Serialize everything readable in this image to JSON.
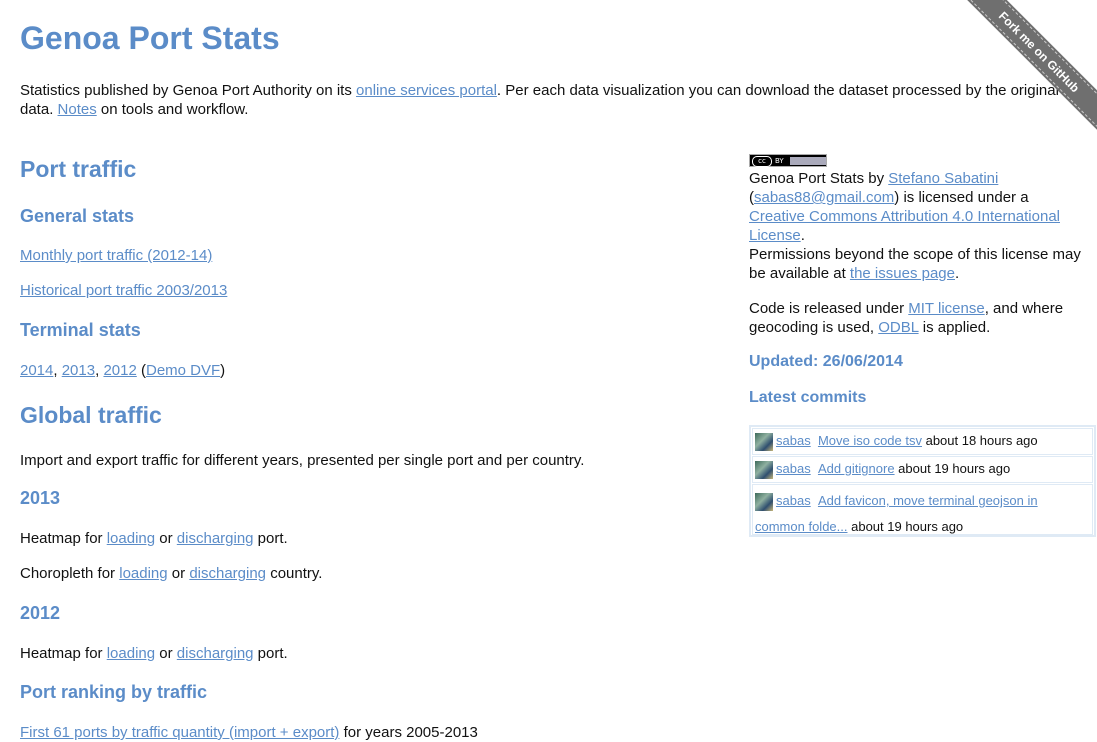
{
  "title": "Genoa Port Stats",
  "intro": {
    "text1": "Statistics published by Genoa Port Authority on its ",
    "link1": "online services portal",
    "text2": ". Per each data visualization you can download the dataset processed by the original data. ",
    "link2": "Notes",
    "text3": " on tools and workflow."
  },
  "ribbon": "Fork me on GitHub",
  "port_traffic": {
    "heading": "Port traffic",
    "general": {
      "heading": "General stats",
      "link_monthly": "Monthly port traffic (2012-14)",
      "link_historical": "Historical port traffic 2003/2013"
    },
    "terminal": {
      "heading": "Terminal stats",
      "y2014": "2014",
      "sep1": ", ",
      "y2013": "2013",
      "sep2": ", ",
      "y2012": "2012",
      "open": " (",
      "demo": "Demo DVF",
      "close": ")"
    }
  },
  "global_traffic": {
    "heading": "Global traffic",
    "desc": "Import and export traffic for different years, presented per single port and per country.",
    "y2013": {
      "heading": "2013",
      "heatmap_prefix": "Heatmap for ",
      "loading": "loading",
      "or": " or ",
      "discharging": "discharging",
      "heatmap_suffix": " port.",
      "choro_prefix": "Choropleth for ",
      "choro_suffix": " country."
    },
    "y2012": {
      "heading": "2012",
      "heatmap_prefix": "Heatmap for ",
      "loading": "loading",
      "or": " or ",
      "discharging": "discharging",
      "heatmap_suffix": " port."
    },
    "ranking": {
      "heading": "Port ranking by traffic",
      "link": "First 61 ports by traffic quantity (import + export)",
      "suffix": " for years 2005-2013"
    }
  },
  "sidebar": {
    "license_badge": {
      "cc": "cc",
      "by": "BY"
    },
    "license": {
      "t1": "Genoa Port Stats by ",
      "author": "Stefano Sabatini",
      "t2": "(",
      "email": "sabas88@gmail.com",
      "t3": ") is licensed under a ",
      "cc_link": "Creative Commons Attribution 4.0 International License",
      "t4": ".",
      "t5": "Permissions beyond the scope of this license may be available at ",
      "issues": "the issues page",
      "t6": "."
    },
    "code": {
      "t1": "Code is released under ",
      "mit": "MIT license",
      "t2": ", and where geocoding is used, ",
      "odbl": "ODBL",
      "t3": " is applied."
    },
    "updated": "Updated: 26/06/2014",
    "latest_commits": "Latest commits",
    "commits": [
      {
        "user": "sabas",
        "message": "Move iso code tsv",
        "time": " about 18 hours ago"
      },
      {
        "user": "sabas",
        "message": "Add gitignore",
        "time": " about 19 hours ago"
      },
      {
        "user": "sabas",
        "message": "Add favicon, move terminal geojson in common folde...",
        "time": " about 19 hours ago"
      }
    ]
  },
  "colors": {
    "accent": "#5b8cc8",
    "ribbon": "#6f6f6f",
    "commit_border": "#dfeaf5"
  }
}
